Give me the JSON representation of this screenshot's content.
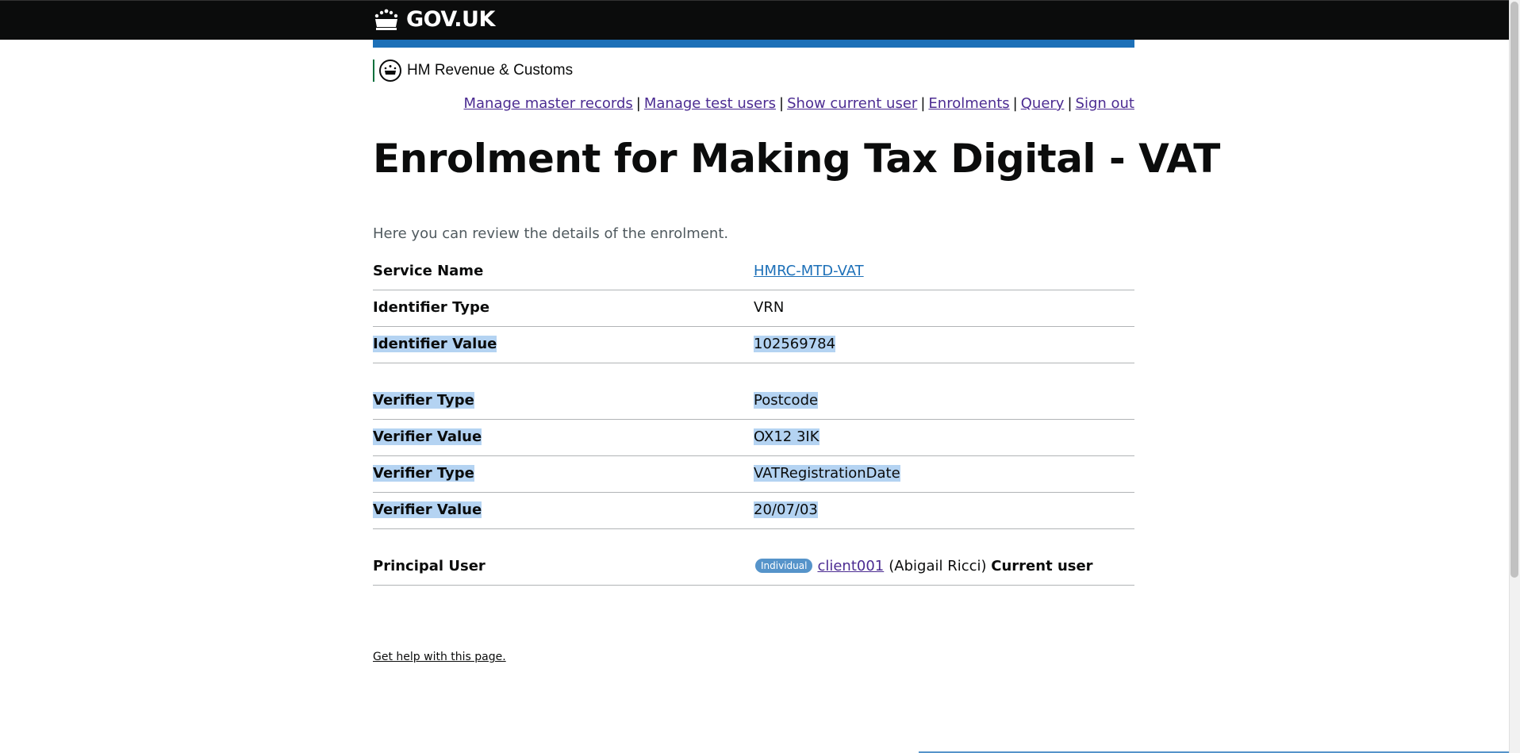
{
  "header": {
    "logo_text": "GOV.UK",
    "dept_name": "HM Revenue & Customs"
  },
  "nav": {
    "items": [
      "Manage master records",
      "Manage test users",
      "Show current user",
      "Enrolments",
      "Query",
      "Sign out"
    ],
    "separator": "|"
  },
  "page": {
    "title": "Enrolment for Making Tax Digital - VAT",
    "intro": "Here you can review the details of the enrolment."
  },
  "details": {
    "service_name": {
      "key": "Service Name",
      "value": "HMRC-MTD-VAT"
    },
    "identifier_type": {
      "key": "Identifier Type",
      "value": "VRN"
    },
    "identifier_value": {
      "key": "Identifier Value",
      "value": "102569784"
    },
    "verifiers": [
      {
        "key": "Verifier Type",
        "value": "Postcode"
      },
      {
        "key": "Verifier Value",
        "value": "OX12 3IK"
      },
      {
        "key": "Verifier Type",
        "value": "VATRegistrationDate"
      },
      {
        "key": "Verifier Value",
        "value": "20/07/03"
      }
    ],
    "principal_user": {
      "key": "Principal User",
      "badge": "Individual",
      "user_id": "client001",
      "user_name": "(Abigail Ricci)",
      "current_label": "Current user"
    }
  },
  "footer": {
    "help_link": "Get help with this page."
  },
  "colors": {
    "header_bg": "#0b0c0c",
    "blue_band": "#1d70b8",
    "link": "#1d70b8",
    "visited_link": "#4c2c92",
    "selection": "#b4d3f2",
    "badge_bg": "#5694ca"
  }
}
